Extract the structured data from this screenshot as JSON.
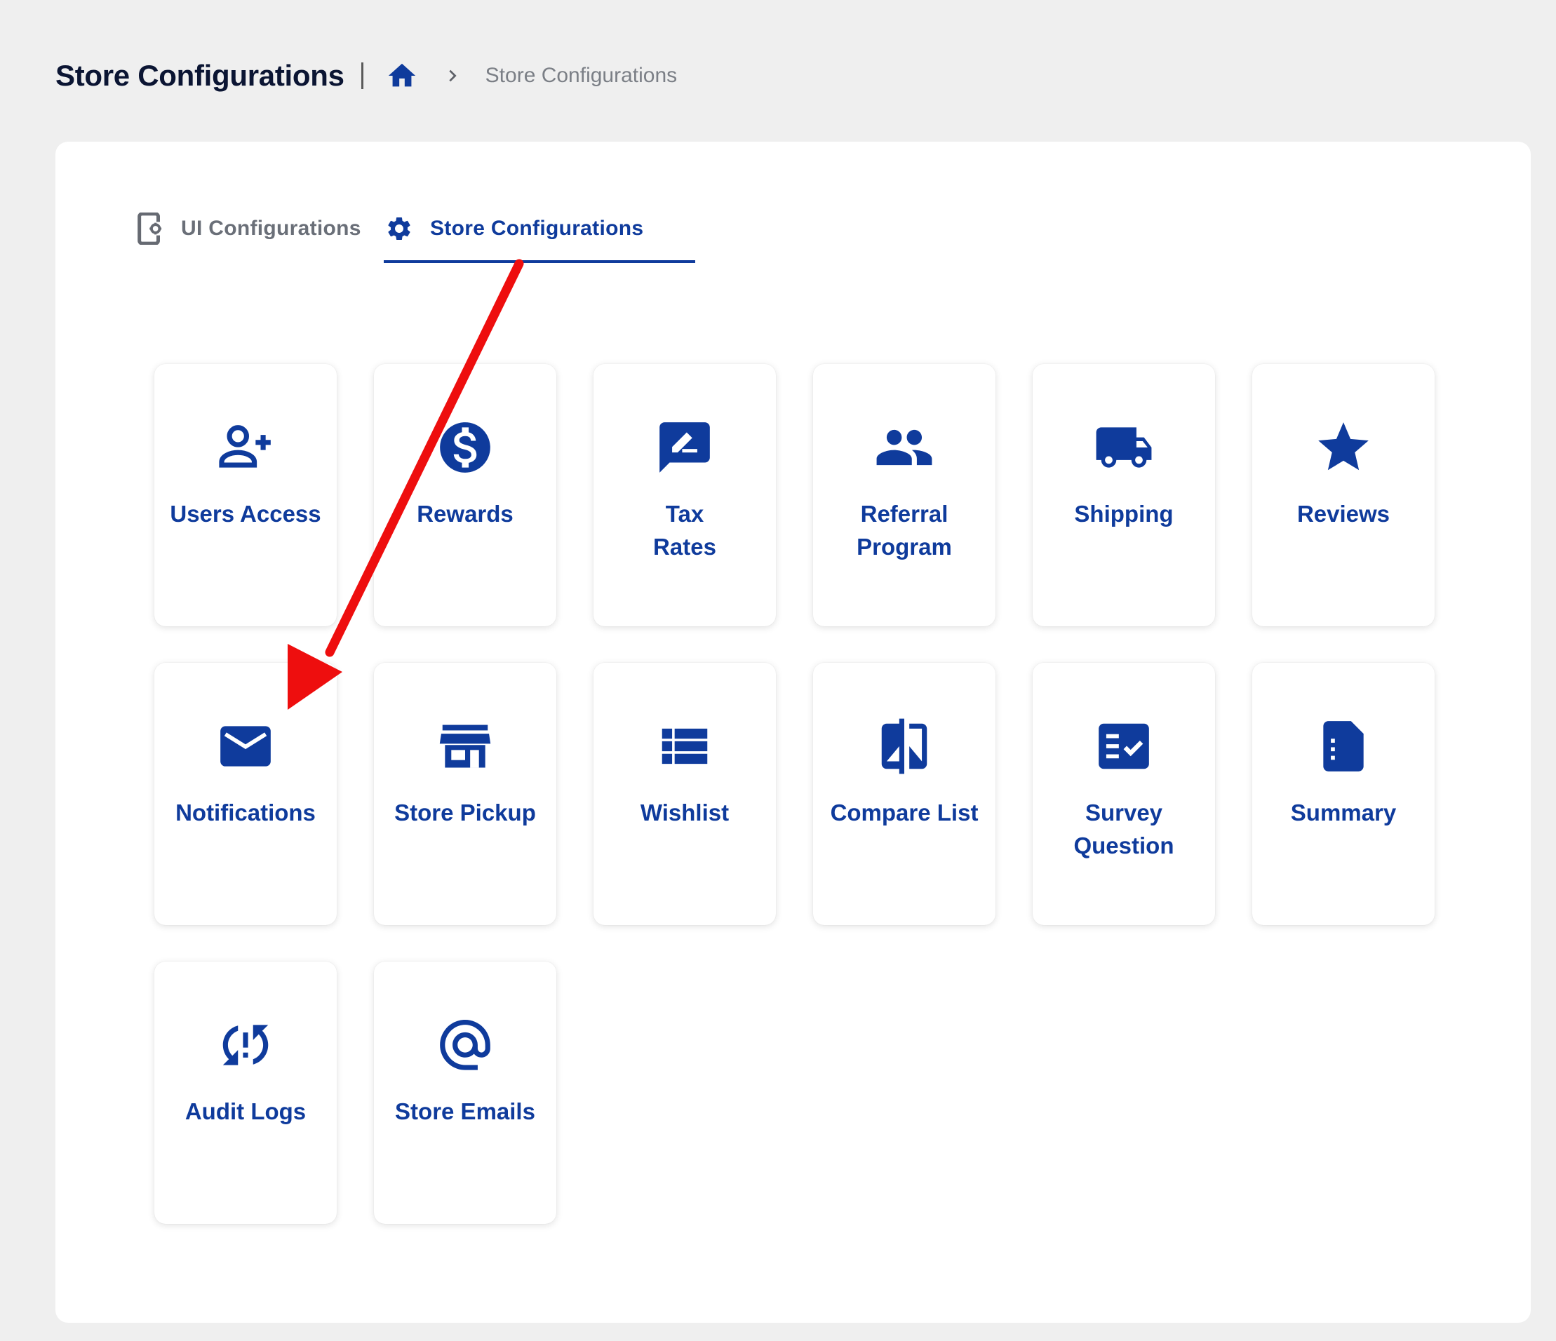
{
  "header": {
    "title": "Store Configurations",
    "breadcrumb": {
      "home_icon": "home-icon",
      "current": "Store Configurations"
    }
  },
  "tabs": [
    {
      "label": "UI Configurations",
      "icon": "device-settings-icon",
      "active": false
    },
    {
      "label": "Store Configurations",
      "icon": "gear-icon",
      "active": true
    }
  ],
  "cards": [
    {
      "label": "Users Access",
      "icon": "person-add-icon"
    },
    {
      "label": "Rewards",
      "icon": "dollar-icon"
    },
    {
      "label": "Tax\nRates",
      "icon": "rate-review-icon"
    },
    {
      "label": "Referral\nProgram",
      "icon": "people-icon"
    },
    {
      "label": "Shipping",
      "icon": "truck-icon"
    },
    {
      "label": "Reviews",
      "icon": "star-icon"
    },
    {
      "label": "Notifications",
      "icon": "mail-icon"
    },
    {
      "label": "Store Pickup",
      "icon": "storefront-icon"
    },
    {
      "label": "Wishlist",
      "icon": "list-icon"
    },
    {
      "label": "Compare List",
      "icon": "compare-icon"
    },
    {
      "label": "Survey\nQuestion",
      "icon": "fact-check-icon"
    },
    {
      "label": "Summary",
      "icon": "document-icon"
    },
    {
      "label": "Audit Logs",
      "icon": "sync-problem-icon"
    },
    {
      "label": "Store Emails",
      "icon": "at-icon"
    }
  ],
  "colors": {
    "accent": "#0f3b9c",
    "annotation_arrow": "#ee0e0e",
    "background": "#efefef"
  }
}
